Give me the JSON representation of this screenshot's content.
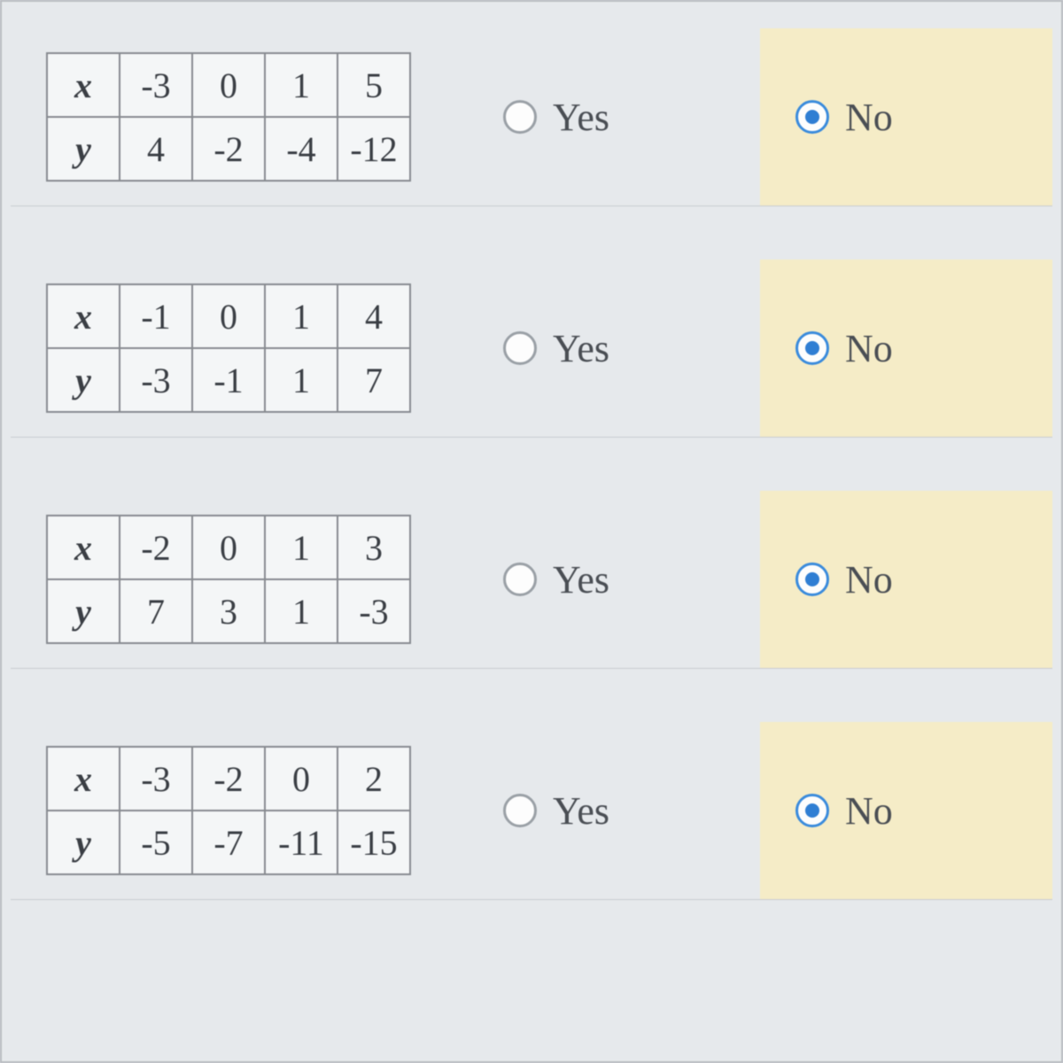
{
  "headers": {
    "x": "x",
    "y": "y"
  },
  "options": {
    "yes": "Yes",
    "no": "No"
  },
  "questions": [
    {
      "x": [
        "-3",
        "0",
        "1",
        "5"
      ],
      "y": [
        "4",
        "-2",
        "-4",
        "-12"
      ],
      "selected": "no"
    },
    {
      "x": [
        "-1",
        "0",
        "1",
        "4"
      ],
      "y": [
        "-3",
        "-1",
        "1",
        "7"
      ],
      "selected": "no"
    },
    {
      "x": [
        "-2",
        "0",
        "1",
        "3"
      ],
      "y": [
        "7",
        "3",
        "1",
        "-3"
      ],
      "selected": "no"
    },
    {
      "x": [
        "-3",
        "-2",
        "0",
        "2"
      ],
      "y": [
        "-5",
        "-7",
        "-11",
        "-15"
      ],
      "selected": "no"
    }
  ]
}
